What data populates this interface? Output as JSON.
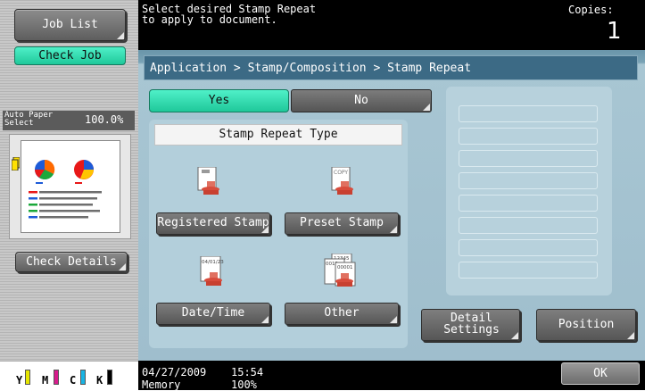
{
  "left": {
    "job_list": "Job List",
    "check_job": "Check Job",
    "paper_select": "Auto Paper\nSelect",
    "zoom": "100.0%",
    "check_details": "Check Details",
    "toner": [
      "Y",
      "M",
      "C",
      "K"
    ]
  },
  "top": {
    "message": "Select desired Stamp Repeat\nto apply to document.",
    "copies_label": "Copies:",
    "copies_value": "1"
  },
  "breadcrumb": "Application > Stamp/Composition > Stamp Repeat",
  "toggle": {
    "yes": "Yes",
    "no": "No",
    "selected": "Yes"
  },
  "stamp_type": {
    "header": "Stamp Repeat Type",
    "registered": "Registered Stamp",
    "preset": "Preset Stamp",
    "datetime": "Date/Time",
    "other": "Other",
    "icon_text_preset": "COPY",
    "icon_text_date": "04/01/23",
    "icon_text_other_a": "12345",
    "icon_text_other_b": "0012",
    "icon_text_other_c": "00001"
  },
  "actions": {
    "detail_settings": "Detail\nSettings",
    "position": "Position",
    "ok": "OK"
  },
  "status": {
    "date": "04/27/2009",
    "time": "15:54",
    "memory_label": "Memory",
    "memory_value": "100%"
  },
  "colors": {
    "accent_green": "#2ad8a8",
    "panel_blue": "#3c6a85",
    "toner_yellow": "#e6e600",
    "toner_magenta": "#d81b8c",
    "toner_cyan": "#18b4e4",
    "toner_black": "#000000"
  }
}
